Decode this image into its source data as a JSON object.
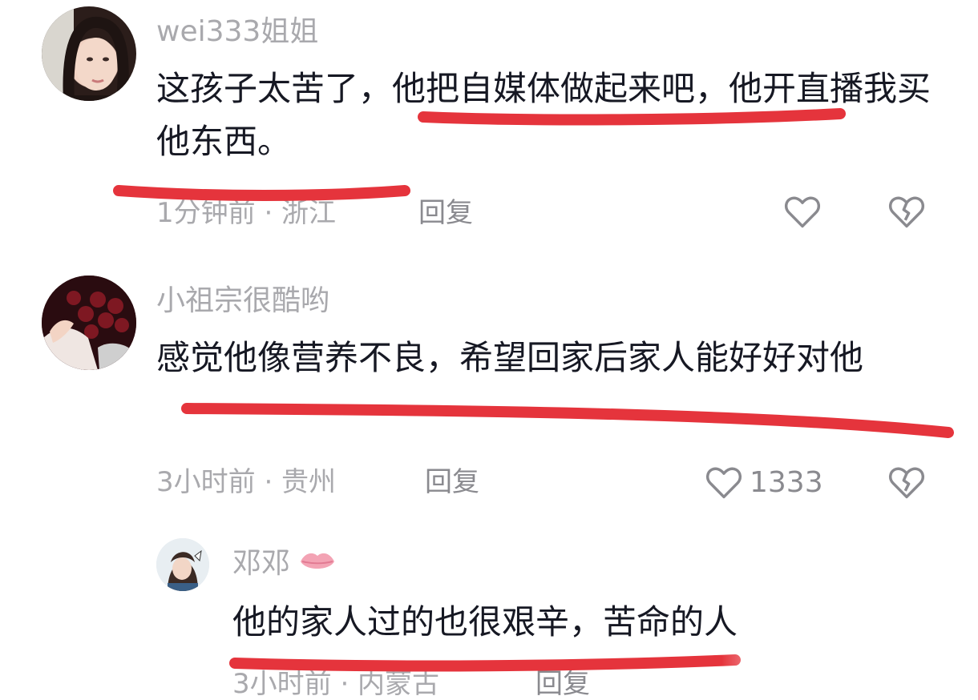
{
  "comments": [
    {
      "username": "wei333姐姐",
      "text": "这孩子太苦了，他把自媒体做起来吧，他开直播我买他东西。",
      "meta": "1分钟前 · 浙江",
      "reply_label": "回复",
      "like_count": ""
    },
    {
      "username": "小祖宗很酷哟",
      "text": "感觉他像营养不良，希望回家后家人能好好对他",
      "meta": "3小时前 · 贵州",
      "reply_label": "回复",
      "like_count": "1333"
    }
  ],
  "reply_thread": {
    "username": "邓邓",
    "text": "他的家人过的也很艰辛，苦命的人",
    "meta": "3小时前 · 内蒙古",
    "reply_label": "回复"
  },
  "colors": {
    "underline": "#e5343c",
    "secondary_text": "#a9a9ad",
    "primary_text": "#161823"
  },
  "icons": [
    "heart-icon",
    "broken-heart-icon",
    "lips-icon"
  ]
}
